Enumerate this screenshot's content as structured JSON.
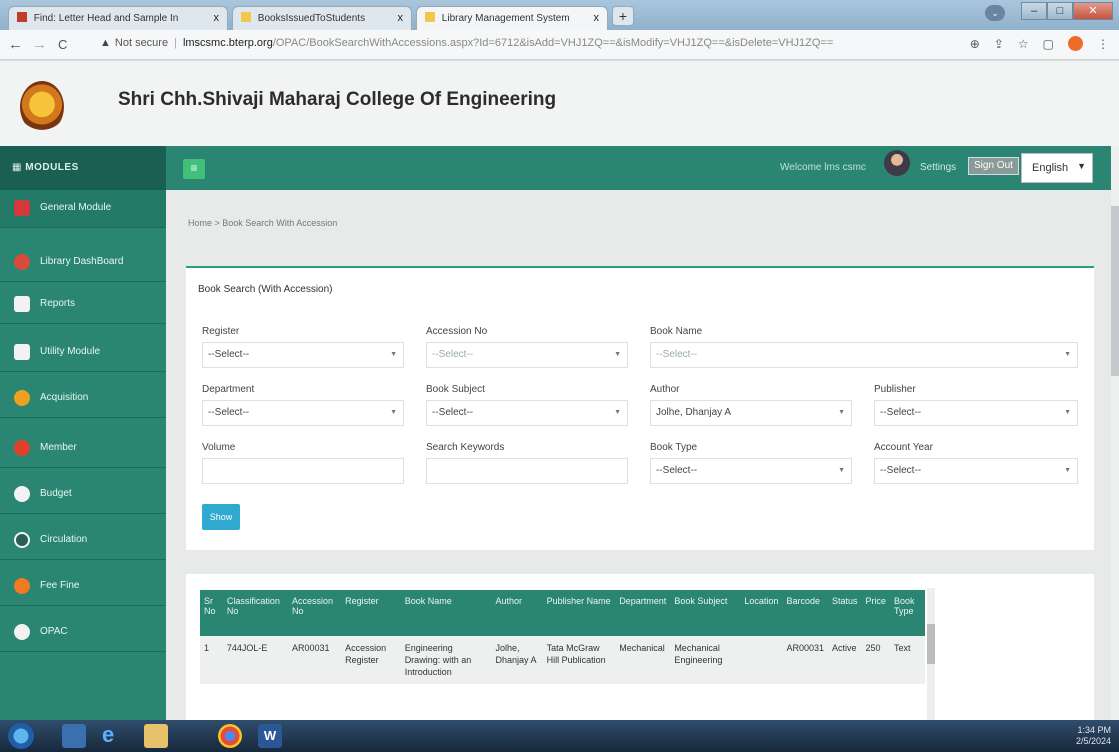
{
  "browser": {
    "tabs": [
      {
        "title": "Find: Letter Head and Sample In",
        "close": "x"
      },
      {
        "title": "BooksIssuedToStudents",
        "close": "x"
      },
      {
        "title": "Library Management System",
        "close": "x"
      }
    ],
    "new_tab": "+",
    "address": {
      "warning": "▲",
      "not_secure": "Not secure",
      "host": "lmscsmc.bterp.org",
      "path": "/OPAC/BookSearchWithAccessions.aspx?Id=6712&isAdd=VHJ1ZQ==&isModify=VHJ1ZQ==&isDelete=VHJ1ZQ=="
    }
  },
  "header": {
    "college_name": "Shri Chh.Shivaji Maharaj College Of Engineering"
  },
  "topbar": {
    "modules_title": "MODULES",
    "welcome": "Welcome lms csmc",
    "settings": "Settings",
    "sign_out": "Sign Out",
    "language": "English"
  },
  "sidebar": {
    "items": [
      {
        "label": "General Module",
        "color": "#d23a3a"
      },
      {
        "label": "Library DashBoard",
        "color": "#d84a3a"
      },
      {
        "label": "Reports",
        "color": "#f2f2f2"
      },
      {
        "label": "Utility Module",
        "color": "#f2f2f2"
      },
      {
        "label": "Acquisition",
        "color": "#f0a020"
      },
      {
        "label": "Member",
        "color": "#e0402a"
      },
      {
        "label": "Budget",
        "color": "#f2f2f2"
      },
      {
        "label": "Circulation",
        "color": "#f2f2f2"
      },
      {
        "label": "Fee Fine",
        "color": "#f07a20"
      },
      {
        "label": "OPAC",
        "color": "#f2f2f2"
      }
    ]
  },
  "breadcrumb": "Home > Book Search With Accession",
  "search_panel": {
    "title": "Book Search (With Accession)",
    "register": {
      "label": "Register",
      "value": "--Select--"
    },
    "accession_no": {
      "label": "Accession No",
      "value": "--Select--"
    },
    "book_name": {
      "label": "Book Name",
      "value": "--Select--"
    },
    "department": {
      "label": "Department",
      "value": "--Select--"
    },
    "book_subject": {
      "label": "Book Subject",
      "value": "--Select--"
    },
    "author": {
      "label": "Author",
      "value": "Jolhe, Dhanjay A"
    },
    "publisher": {
      "label": "Publisher",
      "value": "--Select--"
    },
    "volume": {
      "label": "Volume",
      "value": ""
    },
    "search_keywords": {
      "label": "Search Keywords",
      "value": ""
    },
    "book_type": {
      "label": "Book Type",
      "value": "--Select--"
    },
    "account_year": {
      "label": "Account Year",
      "value": "--Select--"
    },
    "show_button": "Show"
  },
  "results": {
    "columns": [
      "Sr No",
      "Classification No",
      "Accession No",
      "Register",
      "Book Name",
      "Author",
      "Publisher Name",
      "Department",
      "Book Subject",
      "Location",
      "Barcode",
      "Status",
      "Price",
      "Book Type"
    ],
    "rows": [
      [
        "1",
        "744JOL-E",
        "AR00031",
        "Accession Register",
        "Engineering Drawing: with an Introduction",
        "Jolhe, Dhanjay A",
        "Tata McGraw Hill Publication",
        "Mechanical",
        "Mechanical Engineering",
        "",
        "AR00031",
        "Active",
        "250",
        "Text"
      ]
    ]
  },
  "taskbar": {
    "time": "1:34 PM",
    "date": "2/5/2024"
  }
}
